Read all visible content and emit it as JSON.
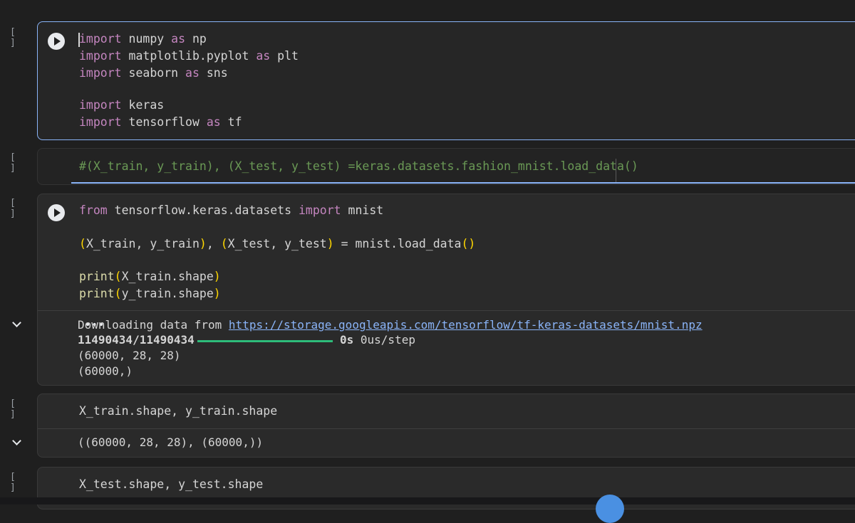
{
  "cells": [
    {
      "bracket": "[ ]",
      "lines": [
        {
          "kw": "import",
          "rest": " numpy ",
          "kw2": "as",
          "rest2": " np"
        },
        {
          "kw": "import",
          "rest": " matplotlib.pyplot ",
          "kw2": "as",
          "rest2": " plt"
        },
        {
          "kw": "import",
          "rest": " seaborn ",
          "kw2": "as",
          "rest2": " sns"
        },
        {
          "kw": "import",
          "rest": " keras",
          "kw2": "",
          "rest2": ""
        },
        {
          "kw": "import",
          "rest": " tensorflow ",
          "kw2": "as",
          "rest2": " tf"
        }
      ]
    },
    {
      "bracket": "[ ]",
      "comment": "#(X_train, y_train), (X_test, y_test) =keras.datasets.fashion_mnist.load_data()"
    },
    {
      "bracket": "[ ]",
      "line1": {
        "kw": "from",
        "mid": " tensorflow.keras.datasets ",
        "kw2": "import",
        "end": " mnist"
      },
      "line2": {
        "p1": "(",
        "a": "X_train, y_train",
        "p2": ")",
        "c": ", ",
        "p3": "(",
        "b": "X_test, y_test",
        "p4": ")",
        "eq": " = mnist.load_data",
        "p5": "()"
      },
      "line3": {
        "fn": "print",
        "p1": "(",
        "arg": "X_train.shape",
        "p2": ")"
      },
      "line4": {
        "fn": "print",
        "p1": "(",
        "arg": "y_train.shape",
        "p2": ")"
      }
    }
  ],
  "output1": {
    "dots": "•••",
    "download_prefix": "Downloading data from ",
    "download_url": "https://storage.googleapis.com/tensorflow/tf-keras-datasets/mnist.npz",
    "progress_count": "11490434/11490434",
    "progress_fraction": 1.0,
    "progress_time": "0s",
    "progress_rate": " 0us/step",
    "shape1": "(60000, 28, 28)",
    "shape2": "(60000,)"
  },
  "cell4": {
    "bracket": "[ ]",
    "code": "X_train.shape, y_train.shape"
  },
  "output2": {
    "text": "((60000, 28, 28), (60000,))"
  },
  "cell5": {
    "bracket": "[ ]",
    "code": "X_test.shape, y_test.shape"
  },
  "colors": {
    "accent": "#8ab4f8",
    "keyword": "#c586c0",
    "comment": "#6a9955",
    "progress": "#2ebc7a"
  }
}
